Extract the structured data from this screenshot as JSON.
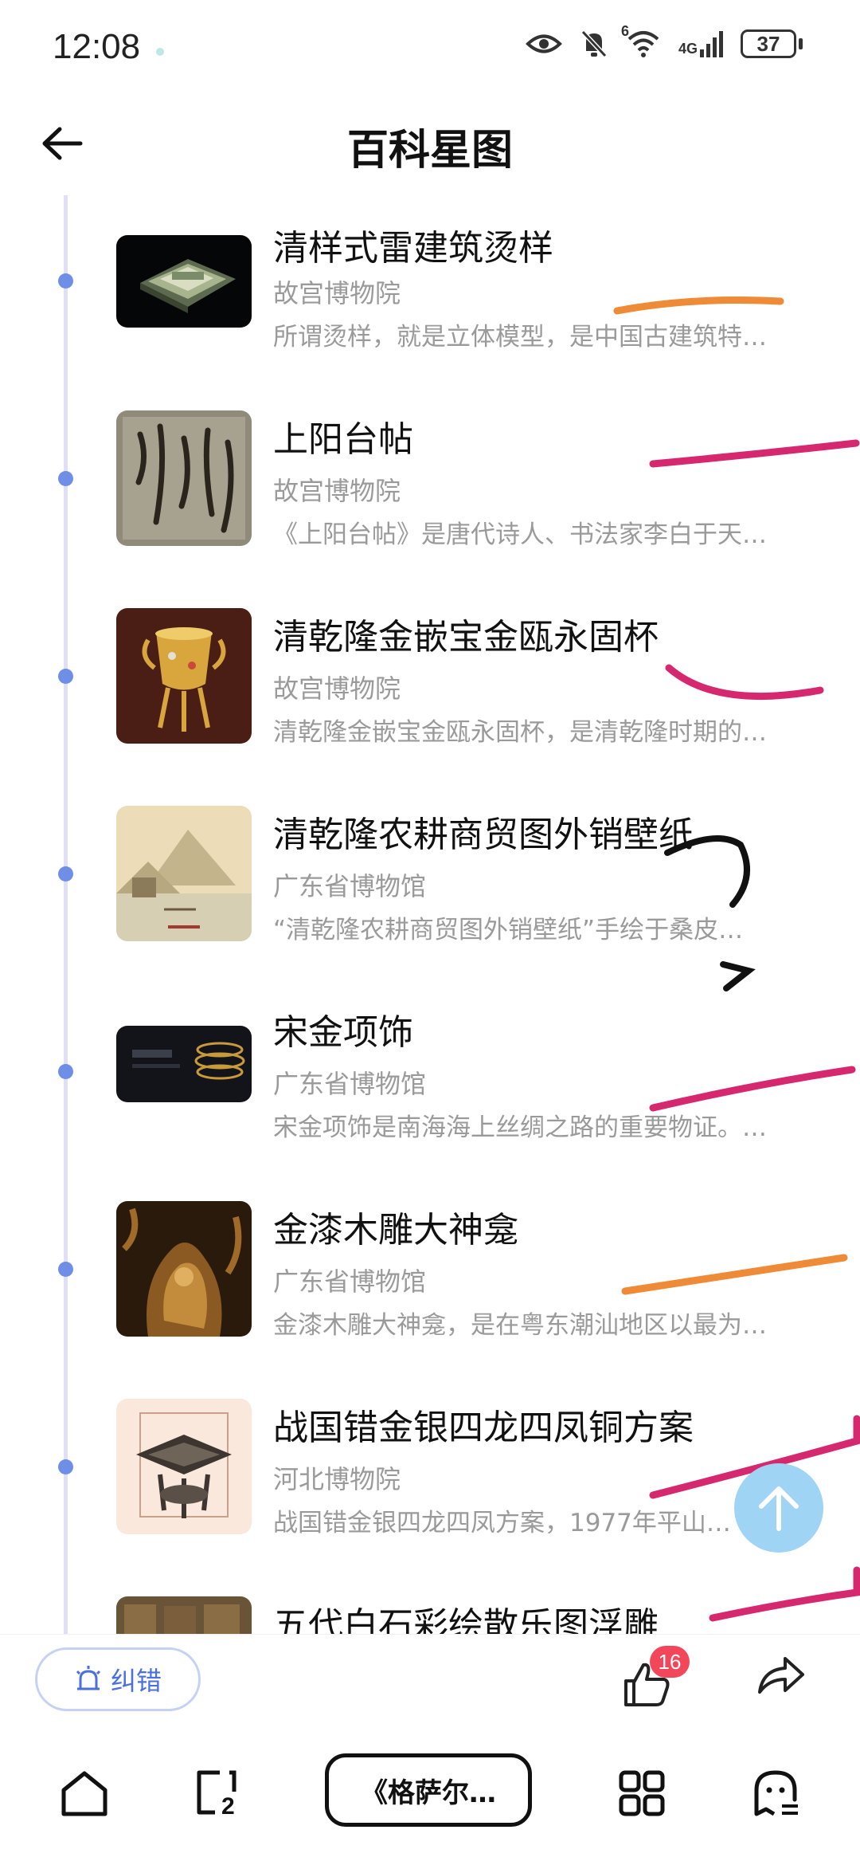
{
  "status_bar": {
    "time": "12:08",
    "network": "4G",
    "wifi_badge": "6",
    "battery": "37"
  },
  "header": {
    "title": "百科星图",
    "back_icon": "arrow-left-icon"
  },
  "items": [
    {
      "title": "清样式雷建筑烫样",
      "museum": "故宫博物院",
      "desc": "所谓烫样，就是立体模型，是中国古建筑特…"
    },
    {
      "title": "上阳台帖",
      "museum": "故宫博物院",
      "desc": "《上阳台帖》是唐代诗人、书法家李白于天…"
    },
    {
      "title": "清乾隆金嵌宝金瓯永固杯",
      "museum": "故宫博物院",
      "desc": "清乾隆金嵌宝金瓯永固杯，是清乾隆时期的…"
    },
    {
      "title": "清乾隆农耕商贸图外销壁纸",
      "museum": "广东省博物馆",
      "desc": "“清乾隆农耕商贸图外销壁纸”手绘于桑皮…"
    },
    {
      "title": "宋金项饰",
      "museum": "广东省博物馆",
      "desc": "宋金项饰是南海海上丝绸之路的重要物证。…"
    },
    {
      "title": "金漆木雕大神龛",
      "museum": "广东省博物馆",
      "desc": "金漆木雕大神龛，是在粤东潮汕地区以最为…"
    },
    {
      "title": "战国错金银四龙四凤铜方案",
      "museum": "河北博物院",
      "desc": "战国错金银四龙四凤方案，1977年平山…"
    },
    {
      "title": "五代白石彩绘散乐图浮雕",
      "museum": "",
      "desc": ""
    }
  ],
  "actions": {
    "report_label": "纠错",
    "like_count": "16"
  },
  "bottom_nav": {
    "tab_label": "《格萨尔…",
    "tab_count": "2"
  },
  "colors": {
    "accent": "#6f8fe6",
    "timeline": "#dfe0f6",
    "badge": "#f2475a",
    "fab": "#9fd4f5"
  }
}
